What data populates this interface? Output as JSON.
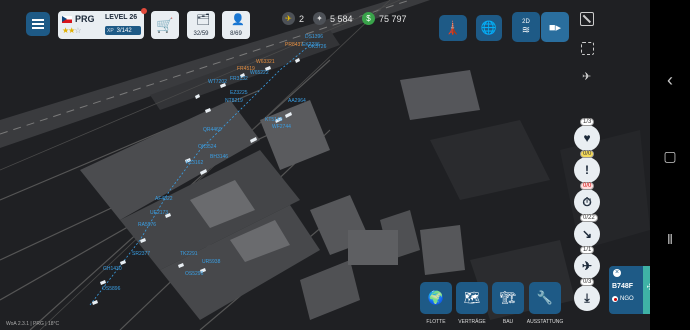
{
  "header": {
    "airport_code": "PRG",
    "level_label": "LEVEL 26",
    "xp_label": "XP",
    "xp_value": "3/142",
    "stand_count": "32/59",
    "staff_count": "8/69"
  },
  "resources": {
    "planes": "2",
    "tokens": "5 584",
    "money": "75 797"
  },
  "view": {
    "mode_label": "2D"
  },
  "side_buttons": [
    {
      "name": "heart",
      "count": "1/3"
    },
    {
      "name": "alert",
      "count": "0/0"
    },
    {
      "name": "timer",
      "count": "0/0"
    },
    {
      "name": "arrivals",
      "count": "0/22"
    },
    {
      "name": "departing",
      "count": "1/1"
    },
    {
      "name": "landing",
      "count": "0/3"
    }
  ],
  "flight_card": {
    "flight": "B748F",
    "route": "NGO"
  },
  "bottom_menu": [
    {
      "label": "Flotte"
    },
    {
      "label": "Verträge"
    },
    {
      "label": "Bau"
    },
    {
      "label": "Ausstattung"
    }
  ],
  "status_bar": {
    "text": "WoA 2.3.1 | PRG | 18°C"
  },
  "aircraft_labels": [
    "DS1396",
    "OK3726",
    "PR8437",
    "EK2236",
    "FR4519",
    "W63321",
    "FR3132",
    "WT7202",
    "W65222",
    "EZ3225",
    "NT8219",
    "AA2964",
    "KT5140",
    "WF2744",
    "QR4469",
    "OK3524",
    "BH3146",
    "KL3162",
    "AF4822",
    "UE2173",
    "RA5976",
    "SR2377",
    "GH1430",
    "OS5896",
    "TK2291",
    "UR5938",
    "OS5296"
  ],
  "colors": {
    "accent": "#1e5a86",
    "label_blue": "#3aa0e6",
    "label_orange": "#e89040",
    "money_green": "#39a34a"
  }
}
